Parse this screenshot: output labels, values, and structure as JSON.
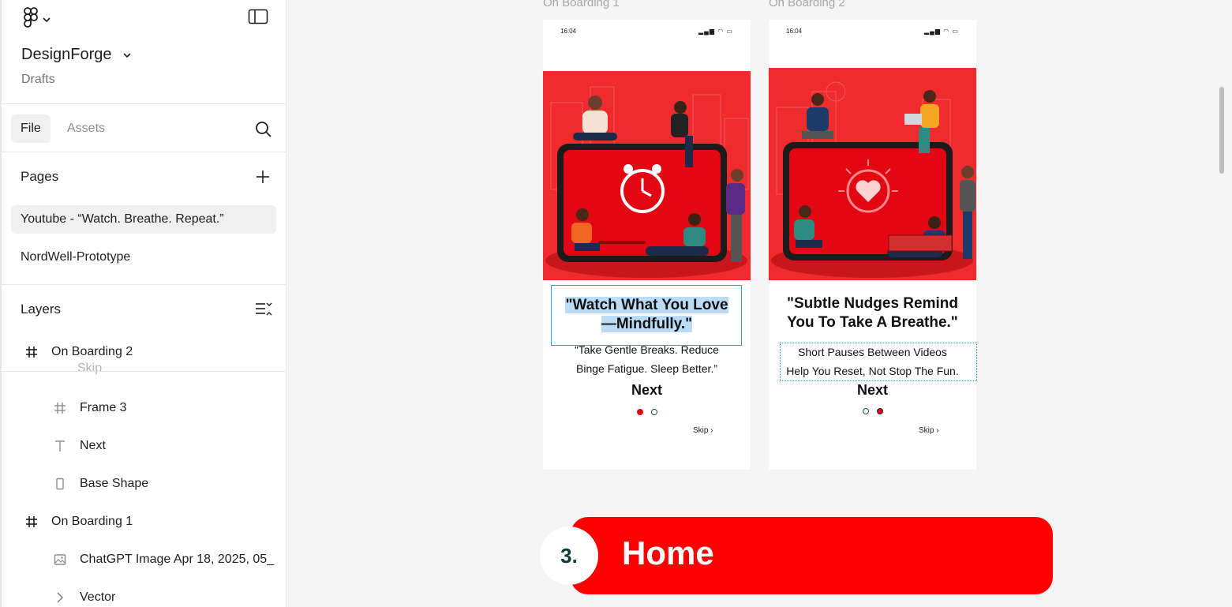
{
  "sidebar": {
    "project_name": "DesignForge",
    "drafts_label": "Drafts",
    "tabs": {
      "file": "File",
      "assets": "Assets"
    },
    "pages_title": "Pages",
    "pages": [
      "Youtube - “Watch. Breathe. Repeat.”",
      "NordWell-Prototype"
    ],
    "layers_title": "Layers",
    "layers": {
      "on_boarding_2": "On Boarding 2",
      "ghost": "Skip",
      "frame_3": "Frame 3",
      "next": "Next",
      "base_shape": "Base Shape",
      "on_boarding_1": "On Boarding 1",
      "chatgpt_image": "ChatGPT Image Apr 18, 2025, 05_",
      "vector": "Vector"
    }
  },
  "canvas": {
    "frame1": {
      "label": "On Boarding 1",
      "time": "16:04",
      "headline_1": "\"Watch What You Love",
      "headline_2": "—Mindfully.\"",
      "sub_1": "“Take Gentle Breaks. Reduce",
      "sub_2": "Binge Fatigue. Sleep Better.”",
      "next": "Next",
      "skip": "Skip"
    },
    "frame2": {
      "label": "On Boarding 2",
      "time": "16:04",
      "headline_1": "\"Subtle Nudges Remind",
      "headline_2": "You To Take A Breathe.\"",
      "sub_1": "Short Pauses Between Videos",
      "sub_2": "Help You Reset, Not Stop The Fun.",
      "next": "Next",
      "skip": "Skip"
    },
    "section": {
      "number": "3.",
      "title": "Home"
    }
  },
  "colors": {
    "accent_red": "#ff0000",
    "selection_blue": "#2d9cdb",
    "sidebar_bg": "#ffffff",
    "canvas_bg": "#f5f5f5"
  },
  "icons": [
    "figma-logo-icon",
    "chevron-down-icon",
    "sidebar-toggle-icon",
    "search-icon",
    "plus-icon",
    "layers-options-icon",
    "frame-icon",
    "text-icon",
    "rectangle-icon",
    "image-icon",
    "chevron-right-icon"
  ]
}
